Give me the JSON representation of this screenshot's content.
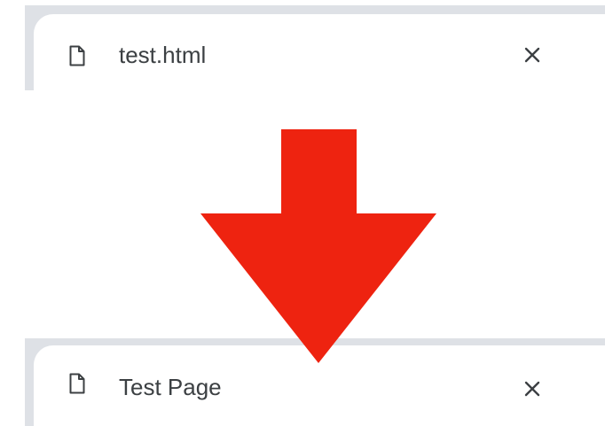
{
  "before_tab": {
    "title": "test.html",
    "icon": "file-icon",
    "close_icon": "close-icon"
  },
  "after_tab": {
    "title": "Test Page",
    "icon": "file-icon",
    "close_icon": "close-icon"
  },
  "arrow": {
    "direction": "down",
    "color": "#ee2310"
  }
}
